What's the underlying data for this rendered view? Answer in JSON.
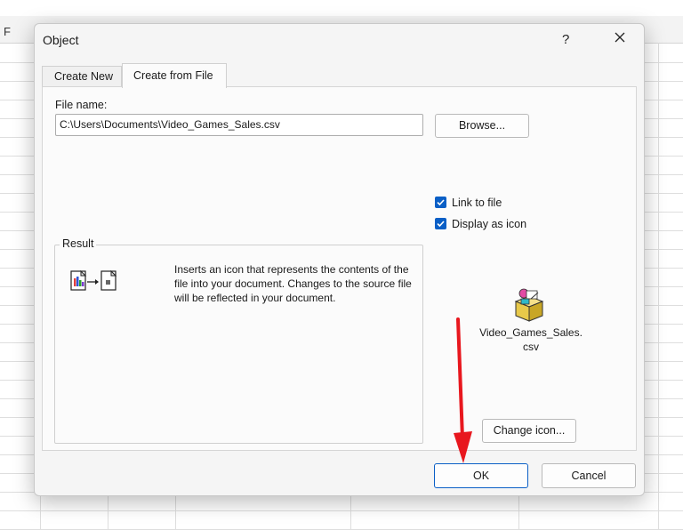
{
  "spreadsheet": {
    "column_label": "F"
  },
  "dialog": {
    "title": "Object",
    "help_label": "?",
    "tabs": [
      {
        "label": "Create New",
        "selected": false
      },
      {
        "label": "Create from File",
        "selected": true
      }
    ],
    "file_name_label": "File name:",
    "file_name_value": "C:\\Users\\Documents\\Video_Games_Sales.csv",
    "browse_label": "Browse...",
    "link_to_file": {
      "label": "Link to file",
      "checked": true
    },
    "display_as_icon": {
      "label": "Display as icon",
      "checked": true
    },
    "result_title": "Result",
    "result_text": "Inserts an icon that represents the contents of the file into your document. Changes to the source file will be reflected in your document.",
    "package_label_line1": "Video_Games_Sales.",
    "package_label_line2": "csv",
    "change_icon_label": "Change icon...",
    "ok_label": "OK",
    "cancel_label": "Cancel",
    "accent_color": "#0a5fc6",
    "annotation_color": "#e8171e"
  }
}
